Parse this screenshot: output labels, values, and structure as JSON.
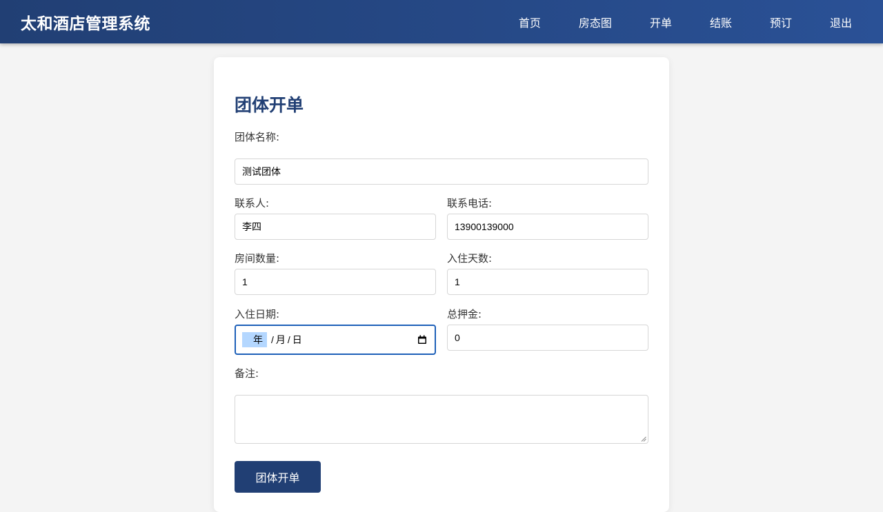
{
  "app": {
    "title": "太和酒店管理系统"
  },
  "nav": {
    "items": [
      {
        "label": "首页"
      },
      {
        "label": "房态图"
      },
      {
        "label": "开单"
      },
      {
        "label": "结账"
      },
      {
        "label": "预订"
      },
      {
        "label": "退出"
      }
    ]
  },
  "form": {
    "title": "团体开单",
    "group_name": {
      "label": "团体名称:",
      "value": "测试团体"
    },
    "contact": {
      "label": "联系人:",
      "value": "李四"
    },
    "phone": {
      "label": "联系电话:",
      "value": "13900139000"
    },
    "room_count": {
      "label": "房间数量:",
      "value": "1"
    },
    "stay_days": {
      "label": "入住天数:",
      "value": "1"
    },
    "checkin_date": {
      "label": "入住日期:",
      "year_placeholder": "年",
      "month_placeholder": "月",
      "day_placeholder": "日",
      "separator": "/",
      "icon": "calendar-icon"
    },
    "deposit": {
      "label": "总押金:",
      "value": "0"
    },
    "notes": {
      "label": "备注:",
      "value": ""
    },
    "submit_label": "团体开单"
  },
  "colors": {
    "header_start": "#213f74",
    "header_end": "#2a5196",
    "accent": "#213f74",
    "focus_border": "#1c5fb8",
    "selection": "#b4d7ff"
  }
}
